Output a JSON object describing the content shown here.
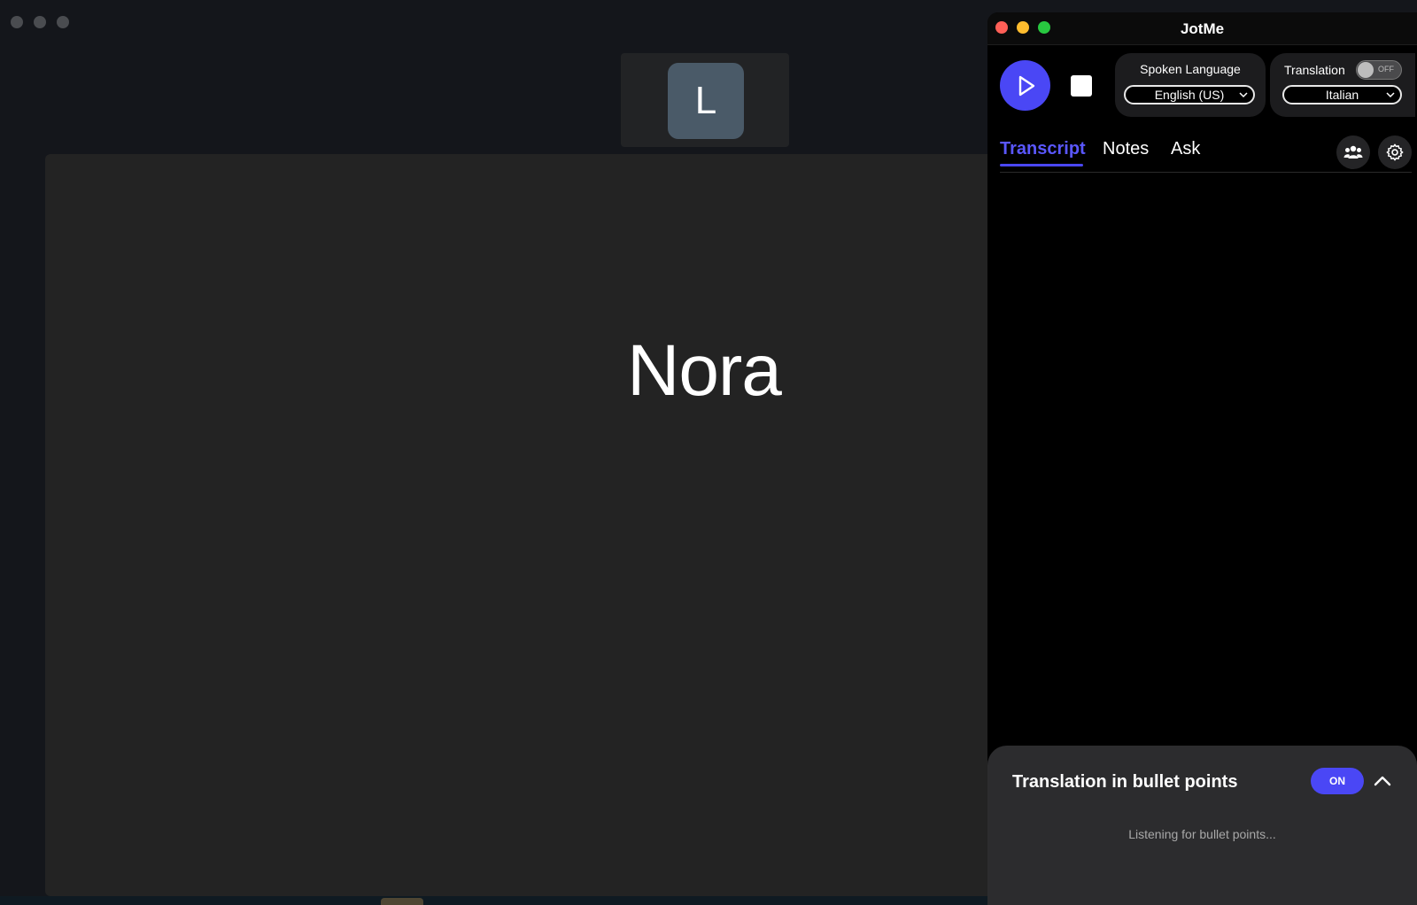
{
  "app": {
    "title": "JotMe"
  },
  "meeting": {
    "thumbnail_initial": "L",
    "active_speaker": "Nora"
  },
  "controls": {
    "spoken_language_label": "Spoken Language",
    "spoken_language_value": "English (US)",
    "translation_label": "Translation",
    "translation_toggle_text": "OFF",
    "translation_language_value": "Italian"
  },
  "tabs": [
    {
      "label": "Transcript",
      "active": true
    },
    {
      "label": "Notes",
      "active": false
    },
    {
      "label": "Ask",
      "active": false
    }
  ],
  "icons": {
    "play": "play-icon",
    "stop": "stop-icon",
    "participants": "people-icon",
    "settings": "gear-icon",
    "collapse": "chevron-up-icon",
    "dropdown": "chevron-down-icon"
  },
  "bullet_panel": {
    "title": "Translation in bullet points",
    "toggle_text": "ON",
    "status_text": "Listening for bullet points..."
  },
  "colors": {
    "accent": "#4a47f5",
    "traffic_close": "#ff5f57",
    "traffic_minimize": "#febc2e",
    "traffic_maximize": "#28c840"
  }
}
